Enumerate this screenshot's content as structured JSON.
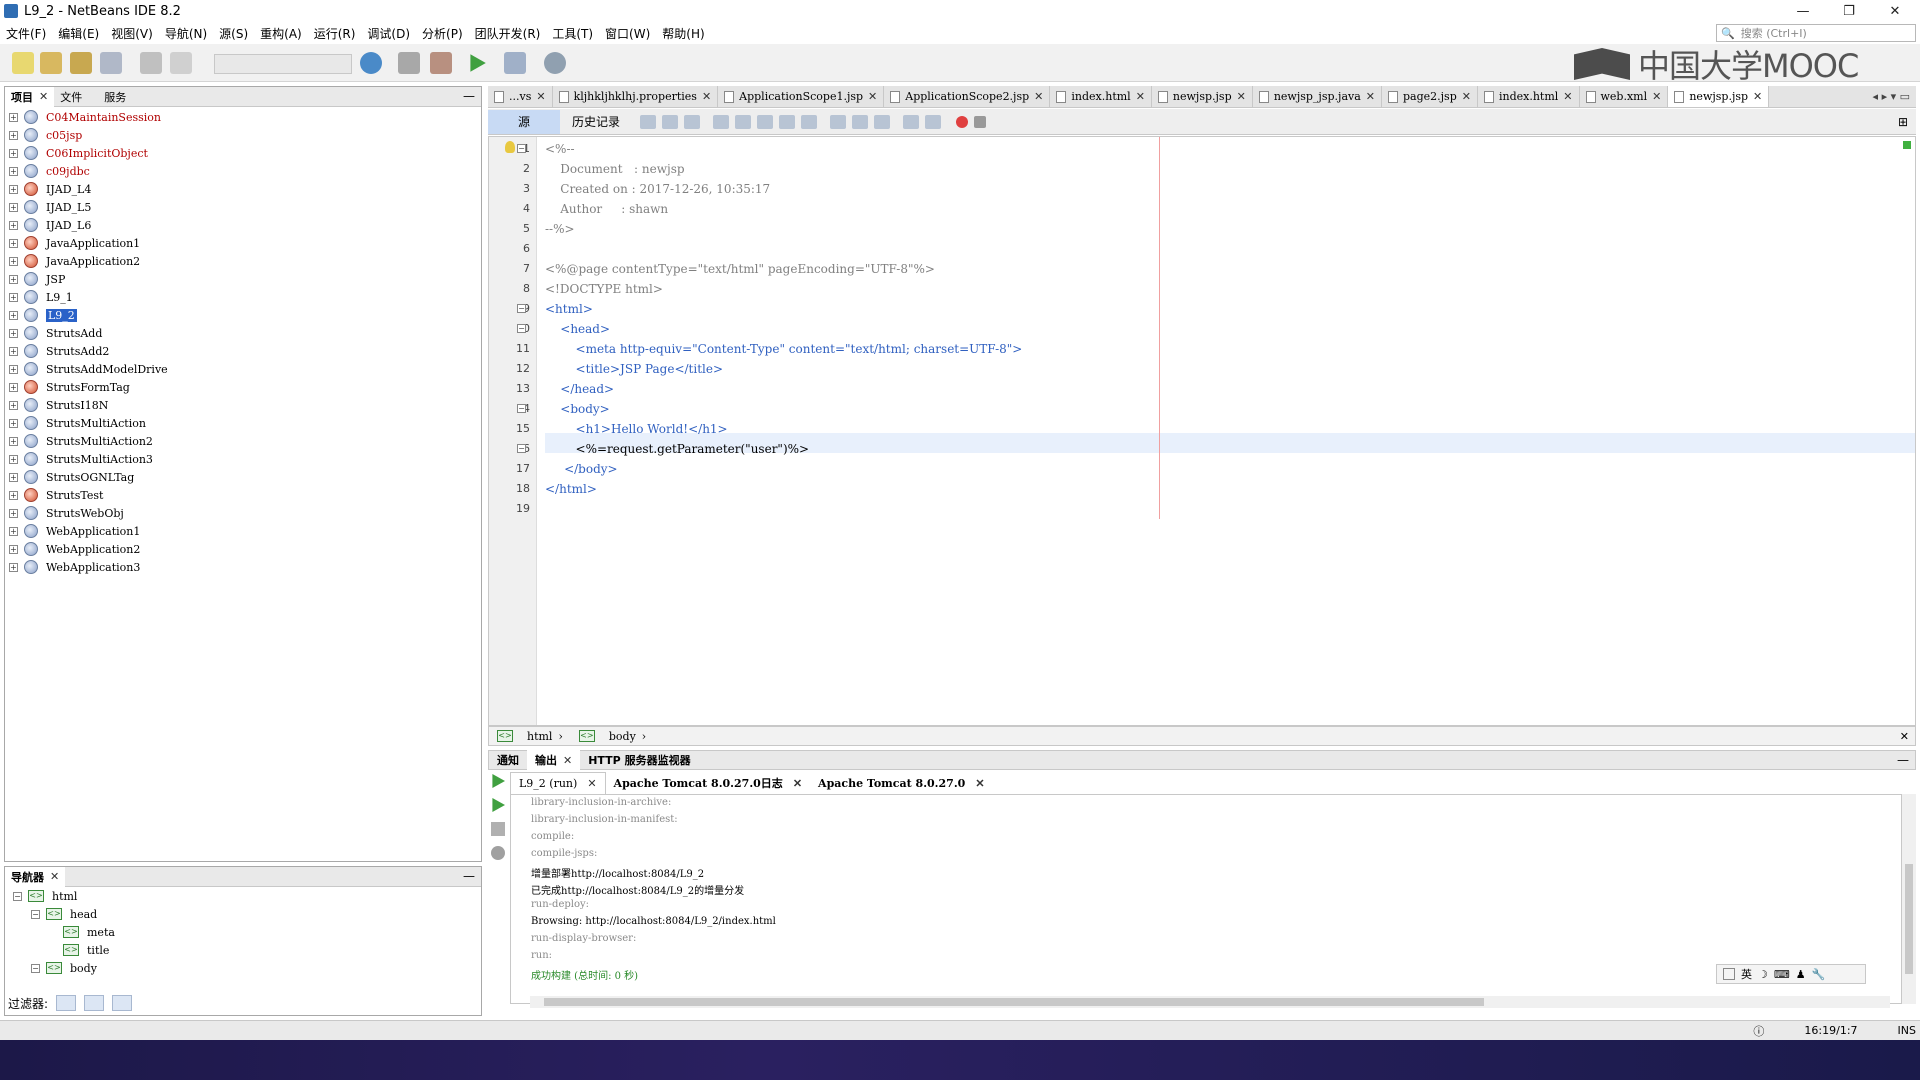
{
  "window": {
    "title": "L9_2 - NetBeans IDE 8.2",
    "minimize": "—",
    "restore": "❐",
    "close": "✕"
  },
  "menu": [
    "文件(F)",
    "编辑(E)",
    "视图(V)",
    "导航(N)",
    "源(S)",
    "重构(A)",
    "运行(R)",
    "调试(D)",
    "分析(P)",
    "团队开发(R)",
    "工具(T)",
    "窗口(W)",
    "帮助(H)"
  ],
  "search": {
    "placeholder": "搜索 (Ctrl+I)"
  },
  "logo": {
    "text": "中国大学MOOC"
  },
  "projects_panel": {
    "tabs": [
      "项目",
      "文件",
      "服务"
    ],
    "items": [
      {
        "label": "C04MaintainSession",
        "err": true
      },
      {
        "label": "c05jsp",
        "err": true
      },
      {
        "label": "C06ImplicitObject",
        "err": true
      },
      {
        "label": "c09jdbc",
        "err": true
      },
      {
        "label": "IJAD_L4",
        "err": false
      },
      {
        "label": "IJAD_L5",
        "err": false
      },
      {
        "label": "IJAD_L6",
        "err": false
      },
      {
        "label": "JavaApplication1",
        "err": false
      },
      {
        "label": "JavaApplication2",
        "err": false
      },
      {
        "label": "JSP",
        "err": false
      },
      {
        "label": "L9_1",
        "err": false
      },
      {
        "label": "L9_2",
        "err": false,
        "selected": true
      },
      {
        "label": "StrutsAdd",
        "err": false
      },
      {
        "label": "StrutsAdd2",
        "err": false
      },
      {
        "label": "StrutsAddModelDrive",
        "err": false
      },
      {
        "label": "StrutsFormTag",
        "err": false
      },
      {
        "label": "StrutsI18N",
        "err": false
      },
      {
        "label": "StrutsMultiAction",
        "err": false
      },
      {
        "label": "StrutsMultiAction2",
        "err": false
      },
      {
        "label": "StrutsMultiAction3",
        "err": false
      },
      {
        "label": "StrutsOGNLTag",
        "err": false
      },
      {
        "label": "StrutsTest",
        "err": false
      },
      {
        "label": "StrutsWebObj",
        "err": false
      },
      {
        "label": "WebApplication1",
        "err": false
      },
      {
        "label": "WebApplication2",
        "err": false
      },
      {
        "label": "WebApplication3",
        "err": false
      }
    ]
  },
  "navigator": {
    "tab": "导航器",
    "items": [
      "html",
      "head",
      "meta",
      "title",
      "body"
    ],
    "filter_label": "过滤器:"
  },
  "editor_tabs": [
    {
      "label": "...vs",
      "active": false
    },
    {
      "label": "kljhkljhklhj.properties",
      "active": false
    },
    {
      "label": "ApplicationScope1.jsp",
      "active": false
    },
    {
      "label": "ApplicationScope2.jsp",
      "active": false
    },
    {
      "label": "index.html",
      "active": false
    },
    {
      "label": "newjsp.jsp",
      "active": false
    },
    {
      "label": "newjsp_jsp.java",
      "active": false
    },
    {
      "label": "page2.jsp",
      "active": false
    },
    {
      "label": "index.html",
      "active": false
    },
    {
      "label": "web.xml",
      "active": false
    },
    {
      "label": "newjsp.jsp",
      "active": true
    }
  ],
  "editor_modes": [
    "源",
    "历史记录"
  ],
  "code": {
    "lines": [
      "<%--",
      "    Document   : newjsp",
      "    Created on : 2017-12-26, 10:35:17",
      "    Author     : shawn",
      "--%>",
      "",
      "<%@page contentType=\"text/html\" pageEncoding=\"UTF-8\"%>",
      "<!DOCTYPE html>",
      "<html>",
      "    <head>",
      "        <meta http-equiv=\"Content-Type\" content=\"text/html; charset=UTF-8\">",
      "        <title>JSP Page</title>",
      "    </head>",
      "    <body>",
      "        <h1>Hello World!</h1>",
      "        <%=request.getParameter(\"user\")%>",
      "     </body>",
      "</html>",
      ""
    ]
  },
  "breadcrumb": [
    "html",
    "body"
  ],
  "output_panel": {
    "tabs": [
      "通知",
      "输出",
      "HTTP 服务器监视器"
    ],
    "run_tabs": [
      "L9_2 (run)",
      "Apache Tomcat 8.0.27.0日志",
      "Apache Tomcat 8.0.27.0"
    ],
    "lines": [
      {
        "text": "library-inclusion-in-archive:",
        "style": "gray"
      },
      {
        "text": "library-inclusion-in-manifest:",
        "style": "gray"
      },
      {
        "text": "compile:",
        "style": "gray"
      },
      {
        "text": "compile-jsps:",
        "style": "gray"
      },
      {
        "text": "增量部署http://localhost:8084/L9_2",
        "style": "black"
      },
      {
        "text": "已完成http://localhost:8084/L9_2的增量分发",
        "style": "black"
      },
      {
        "text": "run-deploy:",
        "style": "gray"
      },
      {
        "text": "Browsing: http://localhost:8084/L9_2/index.html",
        "style": "black"
      },
      {
        "text": "run-display-browser:",
        "style": "gray"
      },
      {
        "text": "run:",
        "style": "gray"
      },
      {
        "text": "成功构建 (总时间: 0 秒)",
        "style": "green"
      }
    ]
  },
  "ime": {
    "label": "英"
  },
  "status": {
    "position": "16:19/1:7",
    "mode": "INS"
  }
}
